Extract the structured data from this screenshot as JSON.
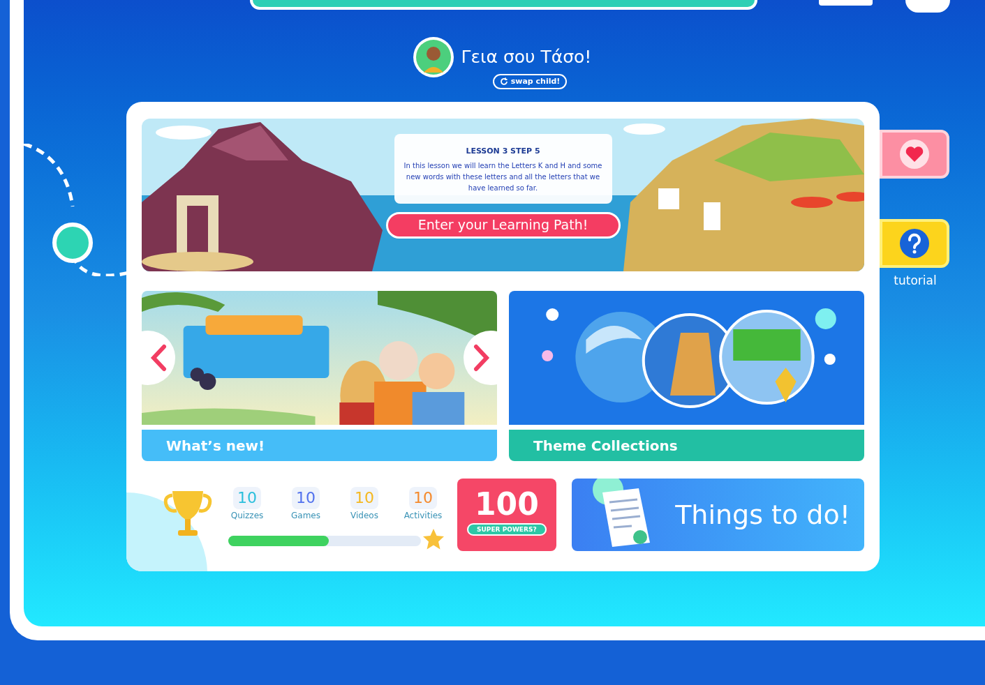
{
  "greeting": {
    "text": "Γεια σου Τάσο!",
    "swap_label": "swap child!"
  },
  "lesson": {
    "title": "LESSON 3 STEP 5",
    "description": "In this lesson we will learn the Letters K and H and some new words with these letters and all the letters that we have learned so far.",
    "button": "Enter your Learning Path!"
  },
  "collections": [
    {
      "kind": "carousel",
      "label": "What’s new!",
      "color": "#45bdf8"
    },
    {
      "kind": "themes",
      "label": "Theme Collections",
      "color": "#22bfa3"
    }
  ],
  "stats": [
    {
      "value": "10",
      "label": "Quizzes",
      "color": "#2bbfdc"
    },
    {
      "value": "10",
      "label": "Games",
      "color": "#5272ee"
    },
    {
      "value": "10",
      "label": "Videos",
      "color": "#f5b820"
    },
    {
      "value": "10",
      "label": "Activities",
      "color": "#f58a2c"
    }
  ],
  "progress": {
    "level": 0.52
  },
  "super_powers": {
    "value": "100",
    "label": "SUPER POWERS?"
  },
  "todo": {
    "label": "Things to do!"
  },
  "side_buttons": [
    {
      "kind": "heart"
    },
    {
      "kind": "help",
      "label": "tutorial"
    }
  ]
}
